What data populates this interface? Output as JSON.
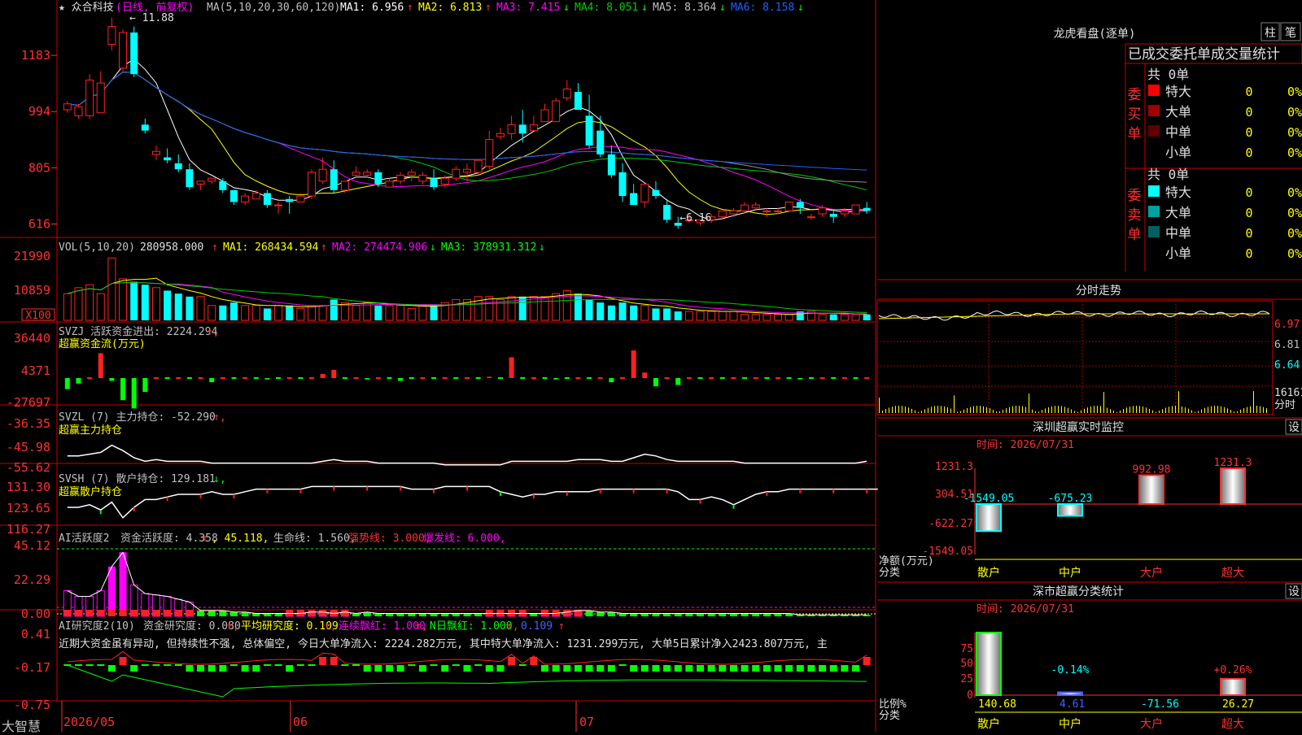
{
  "colors": {
    "up": "#ff2020",
    "down": "#00ffff",
    "ma1": "#ffffff",
    "ma2": "#ffff00",
    "ma3": "#ff00ff",
    "ma4": "#00cc00",
    "ma5": "#909090",
    "ma6": "#2060ff",
    "grid": "#aa0000",
    "panel_border": "#cc0000",
    "text": "#c0c0c0",
    "yellow": "#ffff00",
    "magenta": "#ff00ff",
    "green": "#00ff00",
    "cyan": "#00ffff",
    "red": "#ff3030",
    "blue": "#4060ff"
  },
  "app": {
    "title": "大智慧"
  },
  "price": {
    "stock_name": "★ 众合科技",
    "period": "(日线, 前复权)",
    "ma_prefix": "MA(5,10,20,30,60,120)",
    "ma": [
      {
        "name": "MA1: 6.956",
        "arrow": "↑",
        "color": "#ffffff",
        "arrow_color": "#ff3030"
      },
      {
        "name": "MA2: 6.813",
        "arrow": "↑",
        "color": "#ffff00",
        "arrow_color": "#ff3030"
      },
      {
        "name": "MA3: 7.415",
        "arrow": "↓",
        "color": "#ff00ff",
        "arrow_color": "#00ff00"
      },
      {
        "name": "MA4: 8.051",
        "arrow": "↓",
        "color": "#00cc00",
        "arrow_color": "#00ff00"
      },
      {
        "name": "MA5: 8.364",
        "arrow": "↓",
        "color": "#c0c0c0",
        "arrow_color": "#00ff00"
      },
      {
        "name": "MA6: 8.158",
        "arrow": "↓",
        "color": "#2060ff",
        "arrow_color": "#00ff00"
      }
    ],
    "y_ticks": [
      "1183",
      "994",
      "805",
      "616"
    ],
    "high_label": "11.88",
    "low_label": "6.16",
    "candles": [
      [
        10.0,
        10.3,
        10.2,
        9.9
      ],
      [
        9.8,
        10.2,
        10.1,
        9.7
      ],
      [
        9.8,
        11.2,
        11.0,
        9.7
      ],
      [
        9.9,
        11.3,
        10.9,
        9.9
      ],
      [
        12.2,
        13.1,
        12.8,
        12.0
      ],
      [
        11.4,
        12.7,
        12.6,
        11.3
      ],
      [
        12.6,
        12.8,
        11.2,
        11.1
      ],
      [
        9.5,
        9.7,
        9.3,
        9.2
      ],
      [
        8.5,
        8.8,
        8.6,
        8.3
      ],
      [
        8.4,
        8.7,
        8.3,
        8.2
      ],
      [
        8.2,
        8.5,
        8.0,
        7.9
      ],
      [
        8.0,
        8.2,
        7.4,
        7.3
      ],
      [
        7.5,
        7.6,
        7.6,
        7.3
      ],
      [
        7.6,
        7.7,
        7.7,
        7.5
      ],
      [
        7.6,
        7.7,
        7.3,
        7.2
      ],
      [
        7.3,
        7.3,
        6.9,
        6.8
      ],
      [
        6.9,
        7.2,
        7.1,
        6.8
      ],
      [
        7.0,
        7.3,
        7.2,
        7.0
      ],
      [
        7.2,
        7.3,
        6.8,
        6.7
      ],
      [
        6.8,
        6.9,
        6.8,
        6.5
      ],
      [
        7.0,
        7.1,
        6.9,
        6.5
      ],
      [
        6.9,
        7.2,
        7.1,
        6.9
      ],
      [
        7.1,
        8.0,
        7.9,
        7.0
      ],
      [
        7.6,
        8.4,
        8.0,
        7.5
      ],
      [
        8.0,
        8.3,
        7.3,
        7.2
      ],
      [
        7.3,
        7.6,
        7.6,
        7.2
      ],
      [
        7.8,
        8.1,
        7.9,
        7.7
      ],
      [
        7.8,
        8.0,
        7.9,
        7.7
      ],
      [
        7.9,
        8.0,
        7.5,
        7.4
      ],
      [
        7.4,
        7.7,
        7.6,
        7.4
      ],
      [
        7.6,
        7.9,
        7.8,
        7.5
      ],
      [
        7.8,
        8.0,
        7.9,
        7.6
      ],
      [
        7.6,
        7.9,
        7.8,
        7.5
      ],
      [
        7.7,
        8.0,
        7.4,
        7.3
      ],
      [
        7.5,
        7.8,
        7.7,
        7.4
      ],
      [
        7.7,
        8.1,
        8.0,
        7.6
      ],
      [
        7.9,
        8.2,
        8.0,
        7.6
      ],
      [
        7.9,
        8.3,
        8.3,
        7.8
      ],
      [
        8.1,
        9.3,
        9.0,
        8.0
      ],
      [
        9.1,
        9.4,
        9.2,
        9.0
      ],
      [
        9.2,
        9.8,
        9.5,
        9.0
      ],
      [
        9.5,
        10.0,
        9.2,
        8.9
      ],
      [
        9.3,
        9.8,
        9.5,
        9.3
      ],
      [
        9.6,
        10.2,
        10.0,
        9.6
      ],
      [
        9.6,
        10.4,
        10.3,
        9.6
      ],
      [
        10.4,
        11.0,
        10.7,
        10.3
      ],
      [
        10.6,
        10.9,
        10.0,
        10.0
      ],
      [
        9.8,
        10.5,
        8.8,
        8.7
      ],
      [
        9.3,
        9.8,
        8.5,
        8.4
      ],
      [
        8.5,
        8.8,
        7.8,
        7.7
      ],
      [
        7.9,
        8.2,
        7.1,
        6.9
      ],
      [
        7.2,
        7.5,
        6.8,
        6.8
      ],
      [
        6.9,
        7.2,
        7.5,
        6.7
      ],
      [
        7.3,
        7.6,
        7.1,
        7.0
      ],
      [
        6.8,
        7.0,
        6.3,
        6.2
      ],
      [
        6.2,
        6.4,
        6.1,
        6.0
      ],
      [
        6.3,
        6.5,
        6.3,
        6.2
      ],
      [
        6.2,
        6.3,
        6.3,
        6.1
      ],
      [
        6.3,
        6.5,
        6.4,
        6.2
      ],
      [
        6.4,
        6.6,
        6.6,
        6.3
      ],
      [
        6.5,
        6.7,
        6.6,
        6.4
      ],
      [
        6.6,
        6.9,
        6.8,
        6.5
      ],
      [
        6.7,
        6.9,
        6.8,
        6.6
      ],
      [
        6.6,
        6.7,
        6.6,
        6.4
      ],
      [
        6.6,
        6.7,
        6.6,
        6.5
      ],
      [
        6.6,
        6.9,
        6.9,
        6.6
      ],
      [
        6.9,
        7.0,
        6.7,
        6.5
      ],
      [
        6.4,
        6.5,
        6.4,
        6.3
      ],
      [
        6.5,
        6.8,
        6.7,
        6.4
      ],
      [
        6.5,
        6.6,
        6.4,
        6.2
      ],
      [
        6.5,
        6.7,
        6.6,
        6.4
      ],
      [
        6.5,
        6.8,
        6.8,
        6.5
      ],
      [
        6.7,
        6.9,
        6.6,
        6.5
      ]
    ]
  },
  "vol": {
    "label": "VOL(5,10,20)",
    "value": "280958.000",
    "value_arrow": "↑",
    "ma": [
      {
        "name": "MA1: 268434.594",
        "arrow": "↑",
        "color": "#ffff00",
        "arrow_color": "#ff3030"
      },
      {
        "name": "MA2: 274474.906",
        "arrow": "↓",
        "color": "#ff00ff",
        "arrow_color": "#00ff00"
      },
      {
        "name": "MA3: 378931.312",
        "arrow": "↓",
        "color": "#00ff00",
        "arrow_color": "#00ff00"
      }
    ],
    "y_ticks": [
      "21990",
      "10859"
    ],
    "unit_label": "X100",
    "values": [
      9,
      11,
      12,
      9,
      21,
      14,
      13,
      12,
      11,
      10,
      9,
      8,
      8,
      5,
      5,
      6,
      5,
      5,
      4,
      5,
      5,
      4,
      5,
      5,
      7,
      6,
      5,
      6,
      5,
      5,
      5,
      4,
      5,
      5,
      6,
      7,
      7,
      8,
      8,
      7,
      8,
      8,
      8,
      8,
      9,
      10,
      9,
      7,
      6,
      5,
      6,
      5,
      5,
      4,
      4,
      3,
      3,
      3,
      3,
      3,
      3,
      2,
      2,
      2,
      2,
      2,
      3,
      3,
      2,
      2,
      2,
      2,
      2
    ]
  },
  "svzj": {
    "label": "SVZJ",
    "desc": "活跃资金进出: 2224.294",
    "arrow": "↑",
    "sub": "超赢资金流(万元)",
    "y_ticks": [
      "36440",
      "4371",
      "-27697"
    ],
    "values": [
      -8,
      -4,
      0,
      18,
      -2,
      -16,
      -22,
      -10,
      0,
      0,
      0,
      0,
      0,
      -3,
      0,
      0,
      0,
      0,
      -1,
      0,
      0,
      0,
      0,
      3,
      6,
      0,
      0,
      -1,
      0,
      0,
      -2,
      0,
      0,
      0,
      0,
      0,
      0,
      0,
      1,
      0,
      15,
      0,
      0,
      0,
      -1,
      0,
      0,
      0,
      0,
      -3,
      0,
      20,
      4,
      -6,
      0,
      -5,
      0,
      0,
      0,
      0,
      0,
      0,
      0,
      0,
      0,
      0,
      -1,
      0,
      0,
      0,
      0,
      0,
      0
    ]
  },
  "svzl": {
    "label": "SVZL (7)",
    "desc": "主力持仓: -52.290",
    "arrow": "↑",
    "sub": "超赢主力持仓",
    "y_ticks": [
      "-36.35",
      "-45.98",
      "-55.62"
    ],
    "values": [
      -49,
      -49,
      -48,
      -47,
      -43,
      -46,
      -50,
      -52,
      -51,
      -52,
      -52,
      -52,
      -52,
      -53,
      -53,
      -53,
      -53,
      -53,
      -53,
      -53,
      -53,
      -53,
      -53,
      -52,
      -51,
      -52,
      -52,
      -52,
      -53,
      -53,
      -53,
      -53,
      -53,
      -53,
      -54,
      -54,
      -54,
      -54,
      -54,
      -54,
      -52,
      -52,
      -52,
      -52,
      -52,
      -52,
      -51,
      -51,
      -51,
      -52,
      -52,
      -50,
      -48,
      -49,
      -51,
      -52,
      -52,
      -52,
      -52,
      -52,
      -52,
      -53,
      -53,
      -53,
      -53,
      -53,
      -53,
      -53,
      -53,
      -53,
      -53,
      -53,
      -52
    ]
  },
  "svsh": {
    "label": "SVSH (7)",
    "desc": "散户持仓: 129.181",
    "arrow": "↓",
    "sub": "超赢散户持仓",
    "y_ticks": [
      "131.30",
      "123.65",
      "116.27"
    ],
    "values": [
      121,
      121,
      122,
      120,
      123,
      117,
      121,
      124,
      124,
      125,
      126,
      126,
      126,
      127,
      126,
      126,
      127,
      128,
      128,
      128,
      128,
      128,
      129,
      129,
      129,
      129,
      129,
      129,
      129,
      129,
      129,
      128,
      128,
      128,
      129,
      129,
      129,
      129,
      129,
      127,
      126,
      125,
      126,
      126,
      127,
      127,
      127,
      127,
      128,
      128,
      128,
      128,
      128,
      128,
      128,
      127,
      124,
      124,
      125,
      124,
      122,
      124,
      126,
      127,
      127,
      128,
      128,
      128,
      128,
      128,
      128,
      128,
      128,
      128
    ]
  },
  "ai1": {
    "label": "AI活跃度2",
    "items": [
      {
        "text": "资金活跃度: 4.358",
        "color": "#c0c0c0"
      },
      {
        "text": "↑",
        "color": "#ff3030"
      },
      {
        "text": ", 45.118,",
        "color": "#ffff00"
      },
      {
        "text": "生命线: 1.560,",
        "color": "#c0c0c0"
      },
      {
        "text": "强势线: 3.000,",
        "color": "#ff3030"
      },
      {
        "text": "爆发线: 6.000,",
        "color": "#ff00ff"
      }
    ],
    "y_ticks": [
      "45.12",
      "22.29",
      "0.00"
    ],
    "values": [
      18,
      14,
      14,
      18,
      35,
      45,
      22,
      16,
      15,
      14,
      12,
      10,
      4,
      4,
      4,
      3,
      3,
      2,
      2,
      2,
      2,
      2,
      3,
      3,
      2,
      3,
      2,
      3,
      2,
      2,
      2,
      2,
      2,
      2,
      2,
      2,
      2,
      2,
      2,
      2,
      2,
      2,
      2,
      2,
      2,
      3,
      4,
      4,
      3,
      3,
      2,
      2,
      2,
      2,
      2,
      2,
      2,
      2,
      2,
      2,
      2,
      2,
      2,
      2,
      2,
      2,
      1,
      1,
      1,
      1,
      1,
      1,
      1
    ],
    "pink_idx": [
      0,
      1,
      2,
      3,
      4,
      5,
      6,
      7,
      8,
      9,
      10,
      11,
      20,
      21,
      22,
      23,
      24,
      25,
      38,
      39,
      40,
      41,
      43,
      44,
      45,
      46
    ]
  },
  "ai2": {
    "label": "AI研究度2(10)",
    "items": [
      {
        "text": "资金研究度: 0.080",
        "color": "#c0c0c0"
      },
      {
        "text": "↑,",
        "color": "#ff3030"
      },
      {
        "text": "平均研究度: 0.109",
        "color": "#ffff00"
      },
      {
        "text": "↑,",
        "color": "#ff3030"
      },
      {
        "text": "连续飘红: 1.000",
        "color": "#ff00ff"
      },
      {
        "text": "↑,",
        "color": "#ff3030"
      },
      {
        "text": "N日飘红: 1.000",
        "color": "#00ff00"
      },
      {
        "text": "↑,",
        "color": "#ff3030"
      },
      {
        "text": "0.109",
        "color": "#4060ff"
      },
      {
        "text": "↑",
        "color": "#ff3030"
      }
    ],
    "y_ticks": [
      "0.41",
      "-0.17",
      "-0.75"
    ],
    "comment": "近期大资金虽有异动, 但持续性不强, 总体偏空, 今日大单净流入: 2224.282万元, 其中特大单净流入: 1231.299万元, 大单5日累计净入2423.807万元, 主",
    "bars": [
      0,
      0,
      0,
      0,
      -1,
      1,
      -1,
      0,
      0,
      0,
      0,
      -1,
      -1,
      -1,
      -1,
      0,
      -1,
      -1,
      0,
      0,
      -1,
      0,
      0,
      1,
      1,
      0,
      0,
      -1,
      -1,
      -1,
      -1,
      0,
      -1,
      0,
      -1,
      0,
      -1,
      0,
      -1,
      -1,
      1,
      0,
      1,
      -1,
      -1,
      -1,
      -1,
      -1,
      -1,
      -1,
      0,
      -1,
      -1,
      -1,
      -1,
      -1,
      -1,
      -1,
      -1,
      -1,
      -1,
      -1,
      -1,
      -1,
      -1,
      -1,
      -1,
      -1,
      -1,
      -1,
      -1,
      -1,
      1
    ]
  },
  "x_axis": [
    "2026/05",
    "06",
    "07"
  ],
  "sidebar": {
    "dragon": {
      "title": "龙虎看盘(逐单)",
      "btn_zhu": "柱",
      "btn_bi": "笔",
      "header": "已成交委托单成交量统计",
      "buy_total": "共 0单",
      "buy_label": "委买单",
      "sell_total": "共 0单",
      "sell_label": "委卖单",
      "buy_rows": [
        {
          "name": "特大",
          "count": "0",
          "pct": "0%",
          "color": "#ff0000"
        },
        {
          "name": "大单",
          "count": "0",
          "pct": "0%",
          "color": "#a00000"
        },
        {
          "name": "中单",
          "count": "0",
          "pct": "0%",
          "color": "#600000"
        },
        {
          "name": "小单",
          "count": "0",
          "pct": "0%",
          "color": "#000000"
        }
      ],
      "sell_rows": [
        {
          "name": "特大",
          "count": "0",
          "pct": "0%",
          "color": "#00ffff"
        },
        {
          "name": "大单",
          "count": "0",
          "pct": "0%",
          "color": "#00a0a0"
        },
        {
          "name": "中单",
          "count": "0",
          "pct": "0%",
          "color": "#006060"
        },
        {
          "name": "小单",
          "count": "0",
          "pct": "0%",
          "color": "#000000"
        }
      ]
    },
    "intraday": {
      "title": "分时走势",
      "y_ticks": [
        "6.97",
        "6.81",
        "6.64"
      ],
      "vol_label": "16161",
      "time_label": "分时"
    },
    "sz_monitor": {
      "title": "深圳超赢实时监控",
      "btn": "设",
      "time": "时间: 2026/07/31",
      "y_ticks": [
        "1231.3",
        "304.51",
        "-622.27",
        "-1549.05"
      ],
      "unit": "净额(万元)",
      "cat_label": "分类",
      "categories": [
        "散户",
        "中户",
        "大户",
        "超大"
      ],
      "values": [
        -1549.05,
        -675.23,
        992.98,
        1231.3
      ],
      "value_labels": [
        "-1549.05",
        "-675.23",
        "992.98",
        "1231.3"
      ]
    },
    "sz_class": {
      "title": "深市超赢分类统计",
      "btn": "设",
      "time": "时间: 2026/07/31",
      "y_ticks": [
        "75",
        "50",
        "25",
        "0"
      ],
      "unit": "比例%",
      "cat_label": "分类",
      "categories": [
        "散户",
        "中户",
        "大户",
        "超大"
      ],
      "values": [
        140.68,
        4.61,
        -71.56,
        26.27
      ],
      "value_labels": [
        "140.68",
        "4.61",
        "-71.56",
        "26.27"
      ],
      "pct_labels": [
        "",
        "-0.14%",
        "",
        "+0.26%"
      ]
    }
  }
}
